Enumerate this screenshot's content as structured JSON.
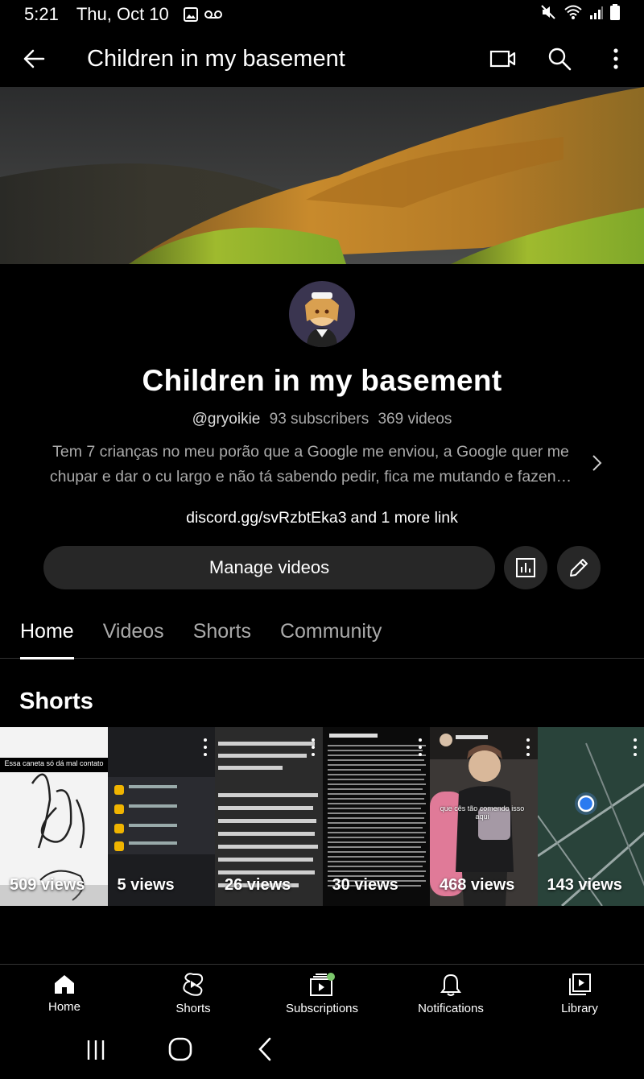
{
  "status": {
    "time": "5:21",
    "date": "Thu, Oct 10"
  },
  "appbar": {
    "title": "Children in my basement"
  },
  "channel": {
    "name": "Children in my basement",
    "handle": "@gryoikie",
    "subscribers": "93 subscribers",
    "videos": "369 videos",
    "description": "Tem 7 crianças no meu porão que a Google me enviou, a Google quer me chupar e dar o cu largo e não tá sabendo pedir, fica me mutando e fazen…",
    "link": "discord.gg/svRzbtEka3",
    "more_links": "and 1 more link"
  },
  "actions": {
    "manage_label": "Manage videos"
  },
  "tabs": [
    {
      "label": "Home"
    },
    {
      "label": "Videos"
    },
    {
      "label": "Shorts"
    },
    {
      "label": "Community"
    }
  ],
  "shorts_section": {
    "title": "Shorts",
    "items": [
      {
        "views": "509 views",
        "caption": "Essa caneta só dá mal contato"
      },
      {
        "views": "5 views"
      },
      {
        "views": "26 views"
      },
      {
        "views": "30 views"
      },
      {
        "views": "468 views",
        "caption": "que cês tão comendo isso aqui"
      },
      {
        "views": "143 views"
      }
    ]
  },
  "bottom_nav": [
    {
      "label": "Home"
    },
    {
      "label": "Shorts"
    },
    {
      "label": "Subscriptions"
    },
    {
      "label": "Notifications"
    },
    {
      "label": "Library"
    }
  ],
  "colors": {
    "background": "#000000",
    "button_bg": "#272727",
    "secondary_text": "#aaaaaa",
    "badge_green": "#7cc86c"
  }
}
